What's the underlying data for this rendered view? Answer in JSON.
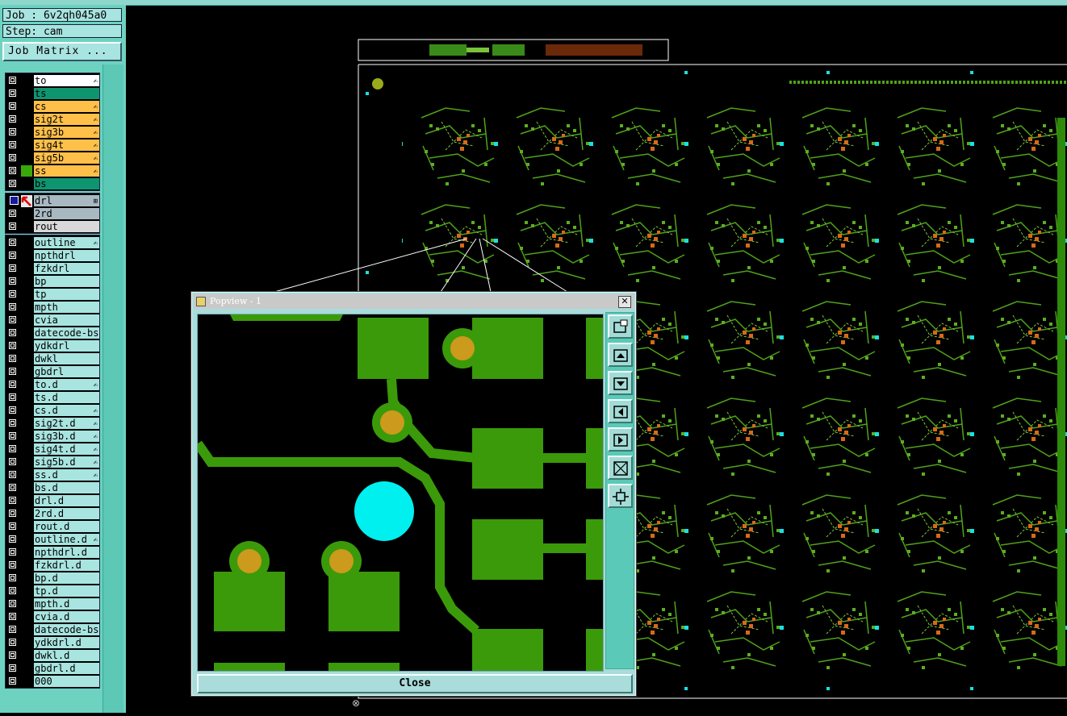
{
  "job": {
    "line": "Job : 6v2qh045a0",
    "step": "Step: cam",
    "matrix_button": "Job Matrix ..."
  },
  "colors": {
    "panel_bg": "#6dd3c0",
    "white_layer": "#ffffff",
    "board_green_layer": "#0f9470",
    "signal_orange_layer": "#ffc04a",
    "drill_gray_layer": "#a9b9c2",
    "rout_layer": "#d8d8d8",
    "misc_layer": "#a8e4e0",
    "copper_green": "#3b9a0a",
    "pad_gold": "#cc9a1c",
    "pad_cyan": "#00f0f0"
  },
  "layer_groups": [
    {
      "layers": [
        {
          "name": "to",
          "color": "#ffffff",
          "mark": "✍"
        },
        {
          "name": "ts",
          "color": "#0f9470",
          "mark": ""
        },
        {
          "name": "cs",
          "color": "#ffc04a",
          "mark": "✍"
        },
        {
          "name": "sig2t",
          "color": "#ffc04a",
          "mark": "✍"
        },
        {
          "name": "sig3b",
          "color": "#ffc04a",
          "mark": "✍"
        },
        {
          "name": "sig4t",
          "color": "#ffc04a",
          "mark": "✍"
        },
        {
          "name": "sig5b",
          "color": "#ffc04a",
          "mark": "✍"
        },
        {
          "name": "ss",
          "color": "#ffc04a",
          "mark": "✍",
          "affected": true
        },
        {
          "name": "bs",
          "color": "#0f9470",
          "mark": ""
        }
      ]
    },
    {
      "layers": [
        {
          "name": "drl",
          "color": "#a9b9c2",
          "mark": "⊞",
          "work": true
        },
        {
          "name": "2rd",
          "color": "#a9b9c2",
          "mark": ""
        },
        {
          "name": "rout",
          "color": "#d8d8d8",
          "mark": ""
        }
      ]
    },
    {
      "layers": [
        {
          "name": "outline",
          "color": "#a8e4e0",
          "mark": "✍"
        },
        {
          "name": "npthdrl",
          "color": "#a8e4e0",
          "mark": ""
        },
        {
          "name": "fzkdrl",
          "color": "#a8e4e0",
          "mark": ""
        },
        {
          "name": "bp",
          "color": "#a8e4e0",
          "mark": ""
        },
        {
          "name": "tp",
          "color": "#a8e4e0",
          "mark": ""
        },
        {
          "name": "mpth",
          "color": "#a8e4e0",
          "mark": ""
        },
        {
          "name": "cvia",
          "color": "#a8e4e0",
          "mark": ""
        },
        {
          "name": "datecode-bs",
          "color": "#a8e4e0",
          "mark": ""
        },
        {
          "name": "ydkdrl",
          "color": "#a8e4e0",
          "mark": ""
        },
        {
          "name": "dwkl",
          "color": "#a8e4e0",
          "mark": ""
        },
        {
          "name": "gbdrl",
          "color": "#a8e4e0",
          "mark": ""
        },
        {
          "name": "to.d",
          "color": "#a8e4e0",
          "mark": "✍"
        },
        {
          "name": "ts.d",
          "color": "#a8e4e0",
          "mark": ""
        },
        {
          "name": "cs.d",
          "color": "#a8e4e0",
          "mark": "✍"
        },
        {
          "name": "sig2t.d",
          "color": "#a8e4e0",
          "mark": "✍"
        },
        {
          "name": "sig3b.d",
          "color": "#a8e4e0",
          "mark": "✍"
        },
        {
          "name": "sig4t.d",
          "color": "#a8e4e0",
          "mark": "✍"
        },
        {
          "name": "sig5b.d",
          "color": "#a8e4e0",
          "mark": "✍"
        },
        {
          "name": "ss.d",
          "color": "#a8e4e0",
          "mark": "✍"
        },
        {
          "name": "bs.d",
          "color": "#a8e4e0",
          "mark": ""
        },
        {
          "name": "drl.d",
          "color": "#a8e4e0",
          "mark": ""
        },
        {
          "name": "2rd.d",
          "color": "#a8e4e0",
          "mark": ""
        },
        {
          "name": "rout.d",
          "color": "#a8e4e0",
          "mark": ""
        },
        {
          "name": "outline.d",
          "color": "#a8e4e0",
          "mark": "✍"
        },
        {
          "name": "npthdrl.d",
          "color": "#a8e4e0",
          "mark": ""
        },
        {
          "name": "fzkdrl.d",
          "color": "#a8e4e0",
          "mark": ""
        },
        {
          "name": "bp.d",
          "color": "#a8e4e0",
          "mark": ""
        },
        {
          "name": "tp.d",
          "color": "#a8e4e0",
          "mark": ""
        },
        {
          "name": "mpth.d",
          "color": "#a8e4e0",
          "mark": ""
        },
        {
          "name": "cvia.d",
          "color": "#a8e4e0",
          "mark": ""
        },
        {
          "name": "datecode-bs",
          "color": "#a8e4e0",
          "mark": ""
        },
        {
          "name": "ydkdrl.d",
          "color": "#a8e4e0",
          "mark": ""
        },
        {
          "name": "dwkl.d",
          "color": "#a8e4e0",
          "mark": ""
        },
        {
          "name": "gbdrl.d",
          "color": "#a8e4e0",
          "mark": ""
        },
        {
          "name": "000",
          "color": "#a8e4e0",
          "mark": ""
        }
      ]
    }
  ],
  "popup": {
    "title": "Popview - 1",
    "close_glyph": "✕",
    "close_button": "Close",
    "tools": [
      "zoom-window-icon",
      "pan-up-icon",
      "pan-down-icon",
      "pan-left-icon",
      "pan-right-icon",
      "zoom-in-icon",
      "zoom-out-icon"
    ]
  }
}
